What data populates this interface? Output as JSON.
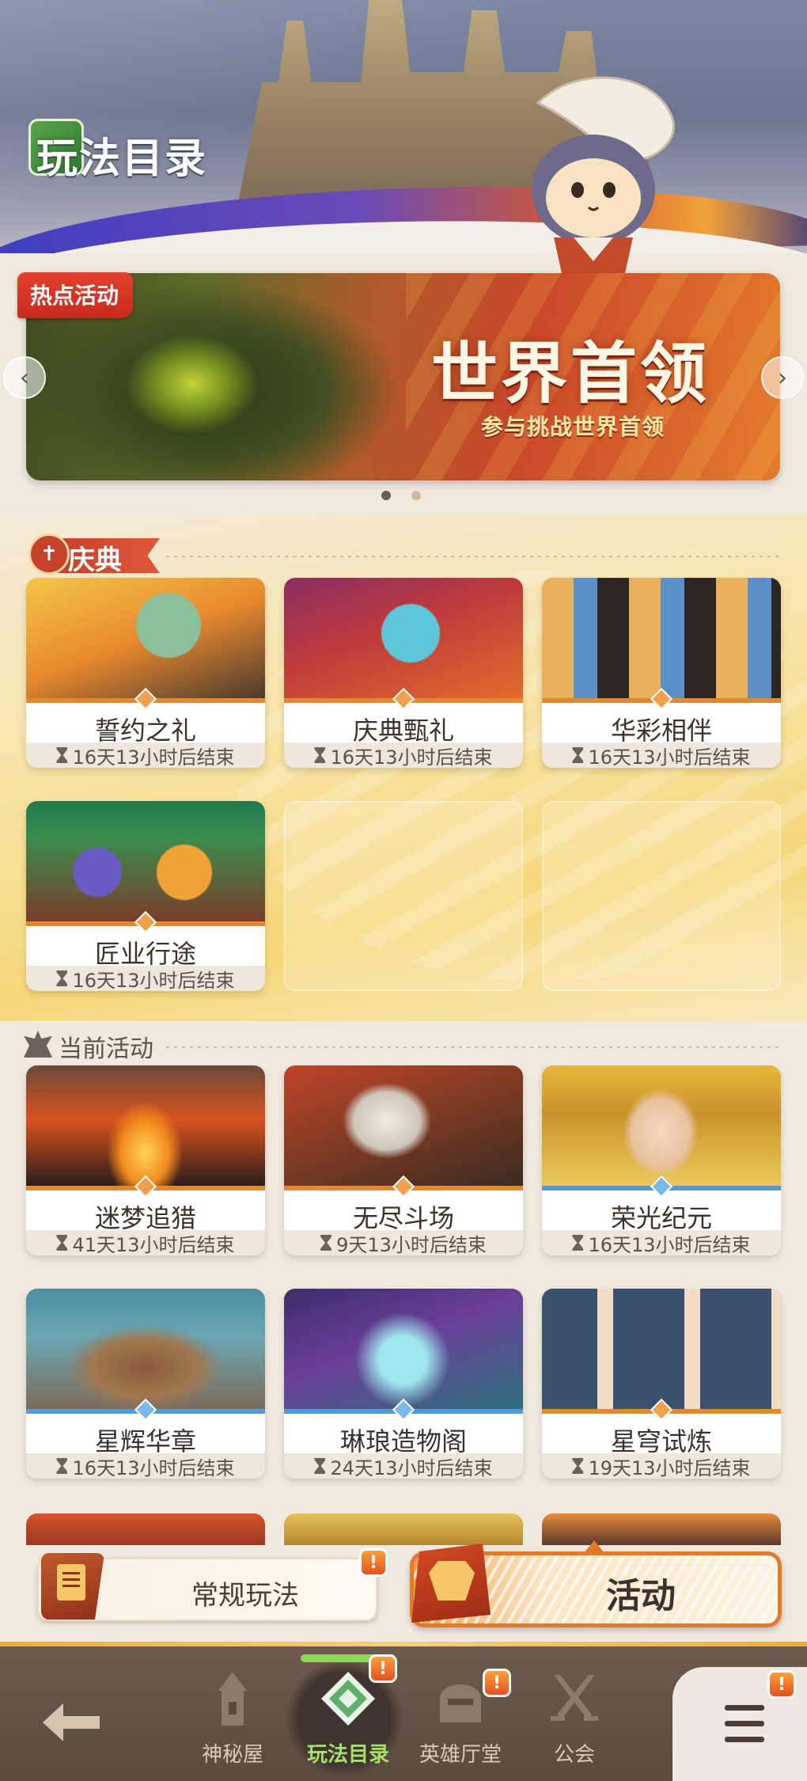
{
  "header": {
    "title": "玩法目录"
  },
  "featured": {
    "badge": "热点活动",
    "title": "世界首领",
    "subtitle": "参与挑战世界首领",
    "prev_icon": "chevron-left-icon",
    "next_icon": "chevron-right-icon",
    "page_count": 2,
    "active_page": 1
  },
  "celebration": {
    "title": "庆典",
    "cards": [
      {
        "name": "誓约之礼",
        "time": "16天13小时后结束"
      },
      {
        "name": "庆典甄礼",
        "time": "16天13小时后结束"
      },
      {
        "name": "华彩相伴",
        "time": "16天13小时后结束"
      },
      {
        "name": "匠业行途",
        "time": "16天13小时后结束"
      }
    ]
  },
  "current": {
    "title": "当前活动",
    "cards": [
      {
        "name": "迷梦追猎",
        "time": "41天13小时后结束"
      },
      {
        "name": "无尽斗场",
        "time": "9天13小时后结束"
      },
      {
        "name": "荣光纪元",
        "time": "16天13小时后结束"
      },
      {
        "name": "星辉华章",
        "time": "16天13小时后结束"
      },
      {
        "name": "琳琅造物阁",
        "time": "24天13小时后结束"
      },
      {
        "name": "星穹试炼",
        "time": "19天13小时后结束"
      }
    ]
  },
  "modes": {
    "normal": "常规玩法",
    "activity": "活动",
    "alert": "!"
  },
  "nav": {
    "items": [
      {
        "label": "神秘屋"
      },
      {
        "label": "玩法目录"
      },
      {
        "label": "英雄厅堂"
      },
      {
        "label": "公会"
      }
    ],
    "alert": "!"
  },
  "colors": {
    "accent_orange": "#e7872c",
    "accent_blue": "#4f9ad8",
    "hot_red": "#d63726",
    "nav_active": "#a6e06a",
    "nav_bg": "#5b4a40"
  }
}
